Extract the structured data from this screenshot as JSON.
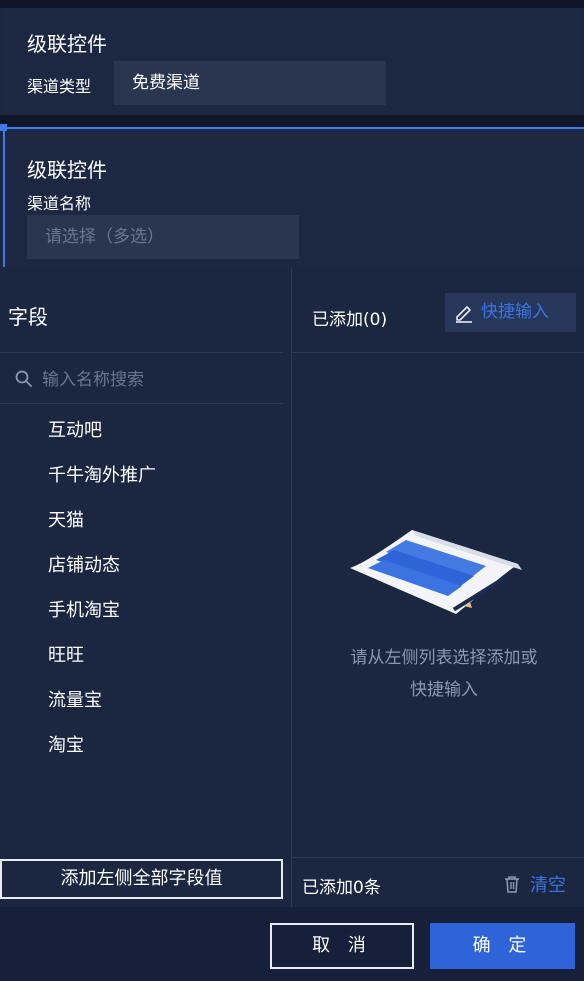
{
  "card1": {
    "title": "级联控件",
    "label": "渠道类型",
    "select_value": "免费渠道"
  },
  "card2": {
    "title": "级联控件",
    "label": "渠道名称",
    "select_placeholder": "请选择（多选）"
  },
  "left_panel": {
    "title": "字段",
    "search_placeholder": "输入名称搜索",
    "items": [
      "互动吧",
      "千牛淘外推广",
      "天猫",
      "店铺动态",
      "手机淘宝",
      "旺旺",
      "流量宝",
      "淘宝"
    ],
    "add_all_label": "添加左侧全部字段值"
  },
  "right_panel": {
    "added_count": "已添加(0)",
    "quick_input_label": "快捷输入",
    "empty_line1": "请从左侧列表选择添加或",
    "empty_line2": "快捷输入",
    "footer_added": "已添加0条",
    "clear_label": "清空"
  },
  "footer": {
    "cancel_label": "取 消",
    "confirm_label": "确 定"
  },
  "colors": {
    "background": "#1b2640",
    "accent": "#3b73e0",
    "primary_button": "#2f64d8"
  }
}
